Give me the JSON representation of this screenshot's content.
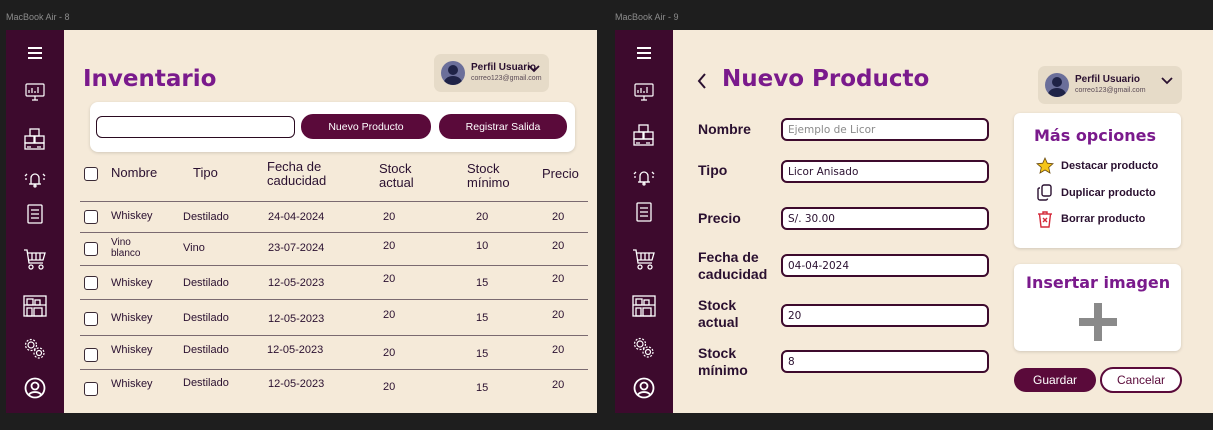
{
  "frames": {
    "left_label": "MacBook Air - 8",
    "right_label": "MacBook Air - 9"
  },
  "colors": {
    "sidebar": "#3d0a2d",
    "background": "#f5ead9",
    "accent_purple": "#7a1a8c",
    "button": "#5a0a3a"
  },
  "sidebar_icons": [
    "menu-icon",
    "dashboard-icon",
    "boxes-icon",
    "alarm-icon",
    "report-icon",
    "cart-icon",
    "shelves-icon",
    "gears-icon",
    "user-icon"
  ],
  "profile": {
    "name": "Perfil Usuario",
    "email": "correo123@gmail.com"
  },
  "inventory": {
    "title": "Inventario",
    "search": {
      "value": "",
      "placeholder": ""
    },
    "new_product_label": "Nuevo Producto",
    "register_exit_label": "Registrar Salida",
    "columns": {
      "nombre": "Nombre",
      "tipo": "Tipo",
      "fecha_1": "Fecha de",
      "fecha_2": "caducidad",
      "stock_actual_1": "Stock",
      "stock_actual_2": "actual",
      "stock_minimo_1": "Stock",
      "stock_minimo_2": "mínimo",
      "precio": "Precio"
    },
    "rows": [
      {
        "nombre": "Whiskey",
        "tipo": "Destilado",
        "fecha": "24-04-2024",
        "stock_actual": "20",
        "stock_minimo": "20",
        "precio": "20"
      },
      {
        "nombre": "Vino blanco",
        "tipo": "Vino",
        "fecha": "23-07-2024",
        "stock_actual": "20",
        "stock_minimo": "10",
        "precio": "20"
      },
      {
        "nombre": "Whiskey",
        "tipo": "Destilado",
        "fecha": "12-05-2023",
        "stock_actual": "20",
        "stock_minimo": "15",
        "precio": "20"
      },
      {
        "nombre": "Whiskey",
        "tipo": "Destilado",
        "fecha": "12-05-2023",
        "stock_actual": "20",
        "stock_minimo": "15",
        "precio": "20"
      },
      {
        "nombre": "Whiskey",
        "tipo": "Destilado",
        "fecha": "12-05-2023",
        "stock_actual": "20",
        "stock_minimo": "15",
        "precio": "20"
      },
      {
        "nombre": "Whiskey",
        "tipo": "Destilado",
        "fecha": "12-05-2023",
        "stock_actual": "20",
        "stock_minimo": "15",
        "precio": "20"
      }
    ]
  },
  "new_product": {
    "back_icon": "chevron-left-icon",
    "title": "Nuevo Producto",
    "fields": {
      "nombre": {
        "label": "Nombre",
        "value": "",
        "placeholder": "Ejemplo de Licor"
      },
      "tipo": {
        "label": "Tipo",
        "value": "Licor Anisado"
      },
      "precio": {
        "label": "Precio",
        "value": "S/. 30.00"
      },
      "fecha_1": "Fecha de",
      "fecha_2": "caducidad",
      "fecha_value": "04-04-2024",
      "stock_actual_1": "Stock",
      "stock_actual_2": "actual",
      "stock_actual_value": "20",
      "stock_minimo_1": "Stock",
      "stock_minimo_2": "mínimo",
      "stock_minimo_value": "8"
    },
    "options": {
      "title": "Más opciones",
      "destacar": "Destacar producto",
      "duplicar": "Duplicar producto",
      "borrar": "Borrar producto"
    },
    "image": {
      "title": "Insertar imagen",
      "icon": "plus-icon"
    },
    "save_label": "Guardar",
    "cancel_label": "Cancelar"
  }
}
